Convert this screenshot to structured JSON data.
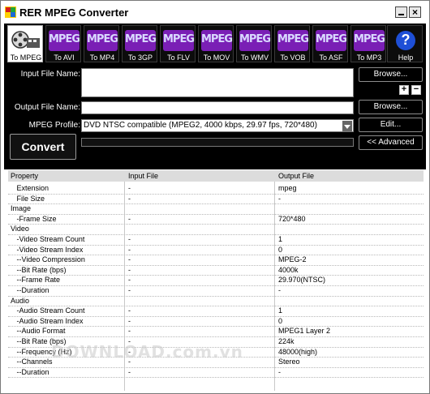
{
  "window": {
    "title": "RER MPEG Converter",
    "close_glyph": "×",
    "icons": {
      "app": "film-reel-icon",
      "minimize": "minimize-icon",
      "close": "close-icon"
    }
  },
  "toolbar": {
    "buttons": [
      {
        "badge": "",
        "label": "To MPEG",
        "icon": "film-reel-icon",
        "active": true
      },
      {
        "badge": "MPEG",
        "label": "To AVI",
        "icon": "mpeg-badge-icon"
      },
      {
        "badge": "MPEG",
        "label": "To MP4",
        "icon": "mpeg-badge-icon"
      },
      {
        "badge": "MPEG",
        "label": "To 3GP",
        "icon": "mpeg-badge-icon"
      },
      {
        "badge": "MPEG",
        "label": "To FLV",
        "icon": "mpeg-badge-icon"
      },
      {
        "badge": "MPEG",
        "label": "To MOV",
        "icon": "mpeg-badge-icon"
      },
      {
        "badge": "MPEG",
        "label": "To WMV",
        "icon": "mpeg-badge-icon"
      },
      {
        "badge": "MPEG",
        "label": "To VOB",
        "icon": "mpeg-badge-icon"
      },
      {
        "badge": "MPEG",
        "label": "To ASF",
        "icon": "mpeg-badge-icon"
      },
      {
        "badge": "MPEG",
        "label": "To MP3",
        "icon": "mpeg-badge-icon"
      },
      {
        "badge": "?",
        "label": "Help",
        "icon": "help-icon"
      }
    ]
  },
  "form": {
    "input_label": "Input File Name:",
    "input_value": "",
    "output_label": "Output File Name:",
    "output_value": "",
    "profile_label": "MPEG Profile:",
    "profile_value": "DVD NTSC compatible (MPEG2, 4000 kbps, 29.97 fps, 720*480)",
    "browse_input": "Browse...",
    "browse_output": "Browse...",
    "add_glyph": "+",
    "remove_glyph": "−",
    "edit": "Edit...",
    "advanced": "<< Advanced",
    "convert": "Convert",
    "progress": 0
  },
  "table": {
    "headers": [
      "Property",
      "Input File",
      "Output File"
    ],
    "rows": [
      {
        "p": "   Extension",
        "i": "-",
        "o": "mpeg"
      },
      {
        "p": "   File Size",
        "i": "-",
        "o": "-"
      },
      {
        "p": "Image",
        "i": "",
        "o": ""
      },
      {
        "p": "   -Frame Size",
        "i": "-",
        "o": "720*480"
      },
      {
        "p": "Video",
        "i": "",
        "o": ""
      },
      {
        "p": "   -Video Stream Count",
        "i": "-",
        "o": "1"
      },
      {
        "p": "   -Video Stream Index",
        "i": "-",
        "o": "0"
      },
      {
        "p": "   --Video Compression",
        "i": "-",
        "o": "MPEG-2"
      },
      {
        "p": "   --Bit Rate (bps)",
        "i": "-",
        "o": "4000k"
      },
      {
        "p": "   --Frame Rate",
        "i": "-",
        "o": "29.970(NTSC)"
      },
      {
        "p": "   --Duration",
        "i": "-",
        "o": "-"
      },
      {
        "p": "Audio",
        "i": "",
        "o": ""
      },
      {
        "p": "   -Audio Stream Count",
        "i": "-",
        "o": "1"
      },
      {
        "p": "   -Audio Stream Index",
        "i": "-",
        "o": "0"
      },
      {
        "p": "   --Audio Format",
        "i": "-",
        "o": "MPEG1 Layer 2"
      },
      {
        "p": "   --Bit Rate (bps)",
        "i": "-",
        "o": "224k"
      },
      {
        "p": "   --Frequency (Hz)",
        "i": "-",
        "o": "48000(high)"
      },
      {
        "p": "   --Channels",
        "i": "-",
        "o": "Stereo"
      },
      {
        "p": "   --Duration",
        "i": "-",
        "o": "-"
      }
    ]
  },
  "watermark": "DOWNLOAD.com.vn",
  "colors": {
    "panel": "#000000",
    "badge_text": "#d9d9ff",
    "badge_bg": "#7a1fb5",
    "help_blue": "#1e4fd6"
  }
}
